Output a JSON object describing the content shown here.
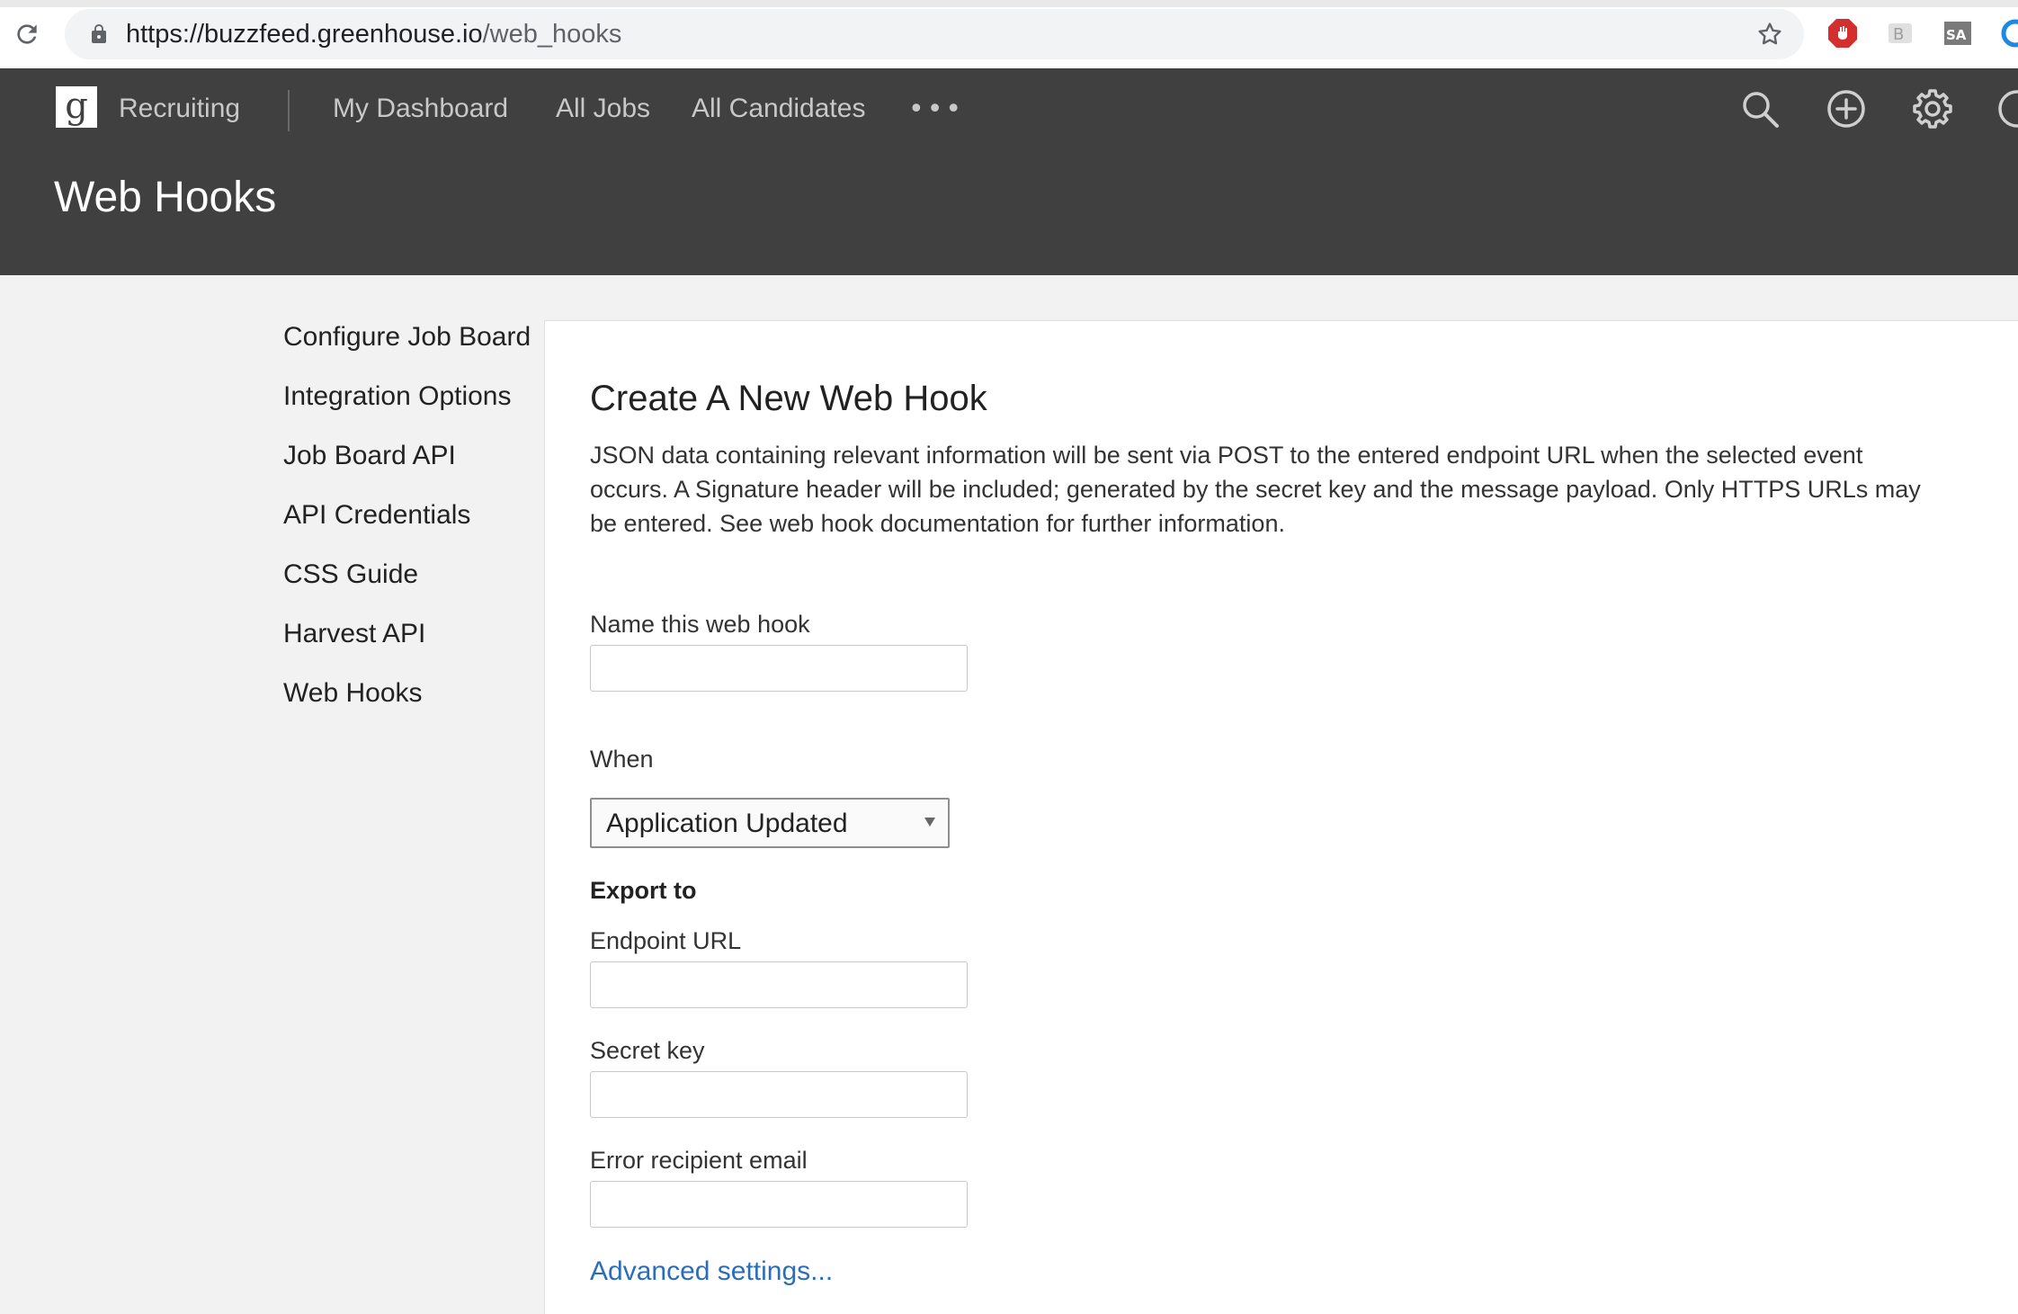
{
  "browser": {
    "url_host": "https://buzzfeed.greenhouse.io",
    "url_path": "/web_hooks"
  },
  "app": {
    "logo_letter": "g",
    "product": "Recruiting",
    "nav": [
      "My Dashboard",
      "All Jobs",
      "All Candidates"
    ],
    "more": "•••",
    "page_title": "Web Hooks"
  },
  "sidebar": {
    "items": [
      {
        "label": "Configure Job Board"
      },
      {
        "label": "Integration Options"
      },
      {
        "label": "Job Board API"
      },
      {
        "label": "API Credentials"
      },
      {
        "label": "CSS Guide"
      },
      {
        "label": "Harvest API"
      },
      {
        "label": "Web Hooks"
      }
    ]
  },
  "form": {
    "title": "Create A New Web Hook",
    "description": "JSON data containing relevant information will be sent via POST to the entered endpoint URL when the selected event occurs. A Signature header will be included; generated by the secret key and the message payload. Only HTTPS URLs may be entered. See web hook documentation for further information.",
    "name_label": "Name this web hook",
    "name_value": "",
    "when_label": "When",
    "when_value": "Application Updated",
    "export_heading": "Export to",
    "endpoint_label": "Endpoint URL",
    "endpoint_value": "",
    "secret_label": "Secret key",
    "secret_value": "",
    "error_email_label": "Error recipient email",
    "error_email_value": "",
    "advanced_link": "Advanced settings..."
  },
  "colors": {
    "header_bg": "#404040",
    "link": "#2a6ebb",
    "page_bg": "#f2f2f2"
  }
}
